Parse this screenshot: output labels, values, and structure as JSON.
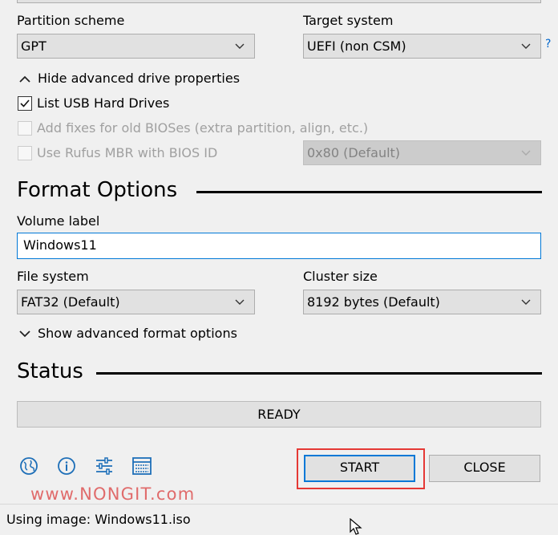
{
  "drive_properties": {
    "partition_scheme_label": "Partition scheme",
    "partition_scheme_value": "GPT",
    "target_system_label": "Target system",
    "target_system_value": "UEFI (non CSM)",
    "help_label": "?",
    "toggle_label": "Hide advanced drive properties",
    "list_usb_label": "List USB Hard Drives",
    "list_usb_checked": true,
    "add_fixes_label": "Add fixes for old BIOSes (extra partition, align, etc.)",
    "rufus_mbr_label": "Use Rufus MBR with BIOS ID",
    "bios_id_value": "0x80 (Default)"
  },
  "format_options": {
    "title": "Format Options",
    "volume_label_label": "Volume label",
    "volume_label_value": "Windows11",
    "file_system_label": "File system",
    "file_system_value": "FAT32 (Default)",
    "cluster_size_label": "Cluster size",
    "cluster_size_value": "8192 bytes (Default)",
    "toggle_label": "Show advanced format options"
  },
  "status": {
    "title": "Status",
    "progress_text": "READY"
  },
  "actions": {
    "start_label": "START",
    "close_label": "CLOSE"
  },
  "watermark": "www.NONGIT.com",
  "footer": {
    "text": "Using image: Windows11.iso"
  },
  "colors": {
    "accent": "#0078d7",
    "highlight": "#e53935",
    "icon_blue": "#1e6fb8"
  },
  "icons": [
    "globe-icon",
    "info-icon",
    "settings-sliders-icon",
    "log-icon"
  ]
}
